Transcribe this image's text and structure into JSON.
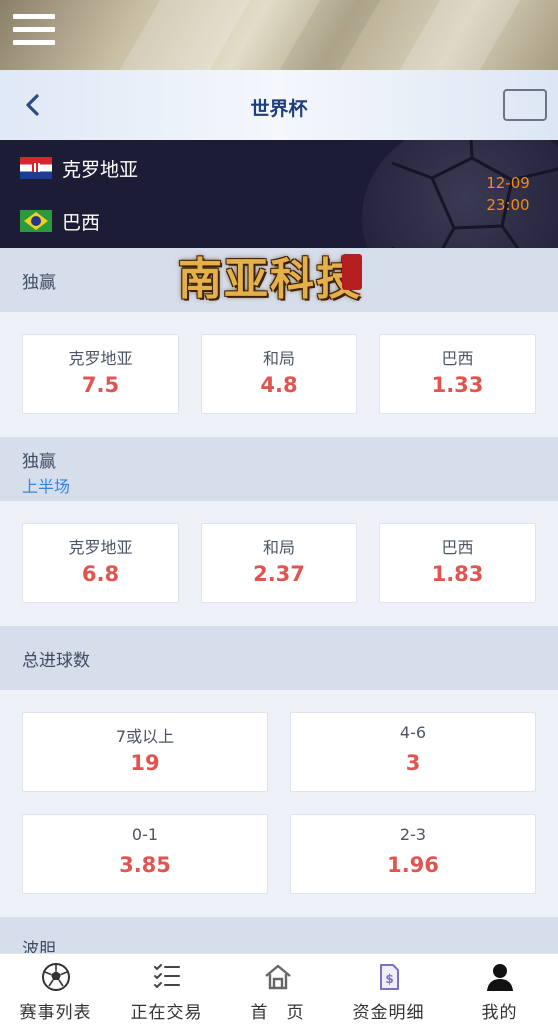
{
  "header": {
    "title": "世界杯"
  },
  "match": {
    "home": {
      "name": "克罗地亚",
      "flag": "croatia-flag"
    },
    "away": {
      "name": "巴西",
      "flag": "brazil-flag"
    },
    "date": "12-09",
    "time": "23:00"
  },
  "watermark": {
    "text": "南亚科技"
  },
  "sections": [
    {
      "title": "独赢",
      "subtitle": "",
      "odds": [
        {
          "label": "克罗地亚",
          "value": "7.5"
        },
        {
          "label": "和局",
          "value": "4.8"
        },
        {
          "label": "巴西",
          "value": "1.33"
        }
      ]
    },
    {
      "title": "独赢",
      "subtitle": "上半场",
      "odds": [
        {
          "label": "克罗地亚",
          "value": "6.8"
        },
        {
          "label": "和局",
          "value": "2.37"
        },
        {
          "label": "巴西",
          "value": "1.83"
        }
      ]
    },
    {
      "title": "总进球数",
      "subtitle": "",
      "odds": [
        {
          "label": "7或以上",
          "value": "19"
        },
        {
          "label": "4-6",
          "value": "3"
        },
        {
          "label": "0-1",
          "value": "3.85"
        },
        {
          "label": "2-3",
          "value": "1.96"
        }
      ]
    },
    {
      "title": "波胆",
      "subtitle": "",
      "odds": []
    }
  ],
  "bottom_nav": [
    {
      "label": "赛事列表",
      "icon": "soccer-ball-icon"
    },
    {
      "label": "正在交易",
      "icon": "checklist-icon"
    },
    {
      "label": "首　页",
      "icon": "home-icon"
    },
    {
      "label": "资金明细",
      "icon": "fund-document-icon"
    },
    {
      "label": "我的",
      "icon": "user-icon"
    }
  ],
  "colors": {
    "odds_value": "#e05550",
    "title": "#1f3f7a",
    "subtitle": "#2f86e0",
    "match_time": "#f08c1a",
    "match_bg": "#1d1c35"
  }
}
